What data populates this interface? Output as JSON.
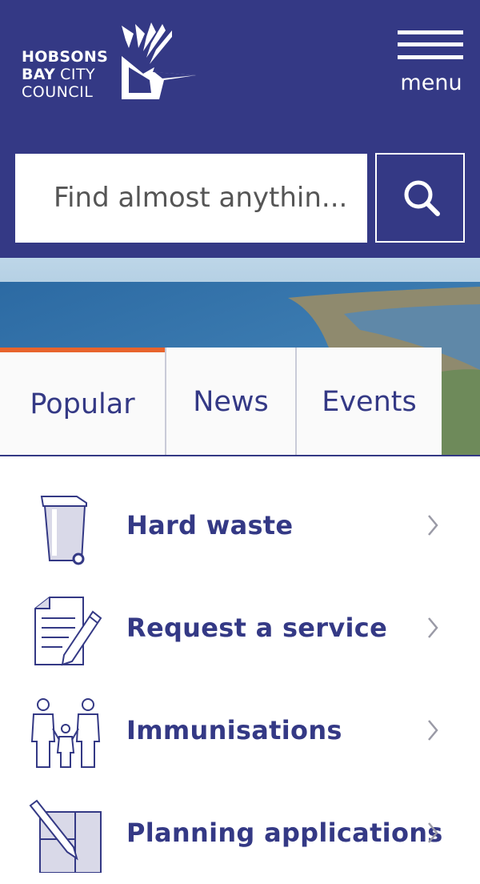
{
  "header": {
    "logo": {
      "line1": "HOBSONS",
      "line2_bold": "BAY",
      "line2_thin": "CITY",
      "line3": "COUNCIL"
    },
    "menu_label": "menu"
  },
  "search": {
    "placeholder": "Find almost anythin..."
  },
  "tabs": [
    {
      "label": "Popular",
      "active": true
    },
    {
      "label": "News",
      "active": false
    },
    {
      "label": "Events",
      "active": false
    }
  ],
  "items": [
    {
      "label": "Hard waste",
      "icon": "wheelie-bin-icon"
    },
    {
      "label": "Request a service",
      "icon": "document-pencil-icon"
    },
    {
      "label": "Immunisations",
      "icon": "family-icon"
    },
    {
      "label": "Planning applications",
      "icon": "plan-pencil-icon"
    }
  ],
  "colors": {
    "brand": "#343985",
    "accent": "#e8642c",
    "background": "#ffffff"
  }
}
